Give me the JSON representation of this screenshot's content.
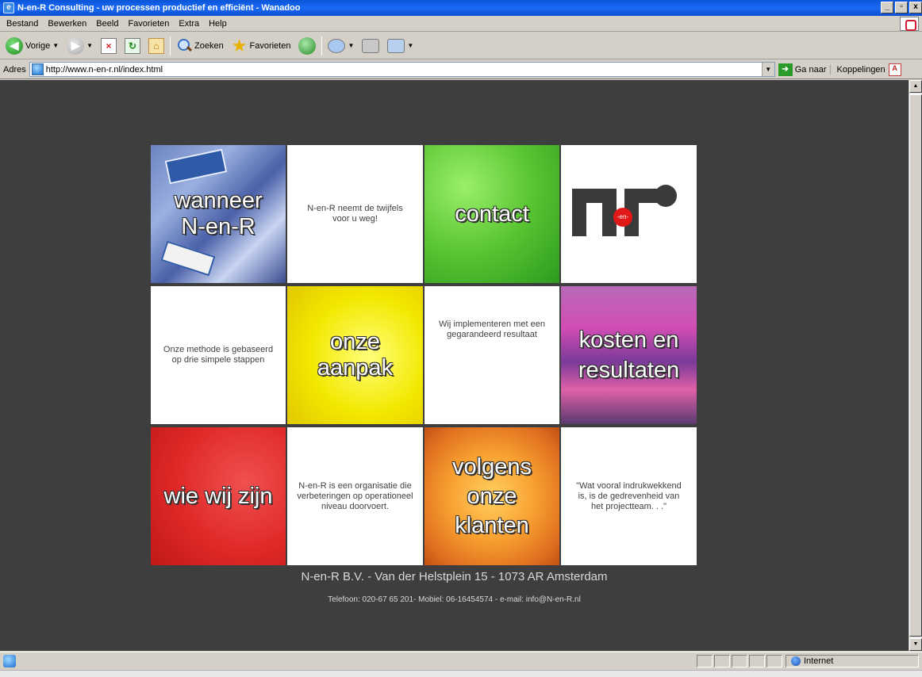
{
  "window": {
    "title": "N-en-R Consulting - uw processen productief en efficiënt - Wanadoo"
  },
  "menu": [
    "Bestand",
    "Bewerken",
    "Beeld",
    "Favorieten",
    "Extra",
    "Help"
  ],
  "toolbar": {
    "back_label": "Vorige",
    "search_label": "Zoeken",
    "favorites_label": "Favorieten"
  },
  "address": {
    "label": "Adres",
    "url": "http://www.n-en-r.nl/index.html",
    "go_label": "Ga naar",
    "links_label": "Koppelingen"
  },
  "tiles": {
    "wanneer": "wanneer N-en-R",
    "wanneer_text": "N-en-R neemt de twijfels voor u weg!",
    "contact": "contact",
    "logo_mid": "-en-",
    "methode_text": "Onze methode is gebaseerd op drie simpele stappen",
    "aanpak": "onze aanpak",
    "implementeren_text": "Wij implementeren met een gegarandeerd resultaat",
    "kosten": "kosten en resultaten",
    "wie": "wie wij zijn",
    "organisatie_text": "N-en-R is een organisatie die verbeteringen op operationeel niveau doorvoert.",
    "volgens": "volgens onze klanten",
    "quote_text": "\"Wat vooral indrukwekkend is, is de gedrevenheid van het projectteam. . .\""
  },
  "footer": {
    "address": "N-en-R B.V. - Van der Helstplein 15 - 1073 AR Amsterdam",
    "contact": "Telefoon: 020-67 65 201- Mobiel: 06-16454574 - e-mail: info@N-en-R.nl"
  },
  "status": {
    "zone": "Internet"
  }
}
